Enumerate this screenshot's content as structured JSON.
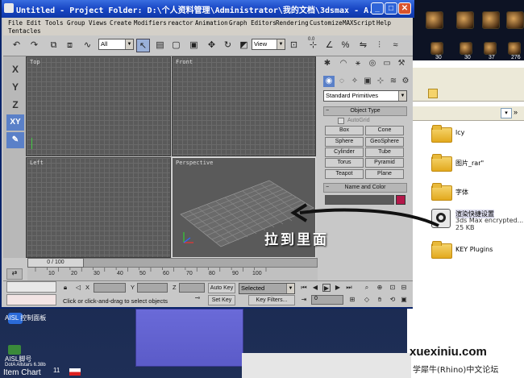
{
  "max": {
    "title": "Untitled   - Project Folder: D:\\个人资料管理\\Administrator\\我的文档\\3dsmax   - A...",
    "menus": [
      "File",
      "Edit",
      "Tools",
      "Group",
      "Views",
      "Create",
      "Modifiers",
      "reactor",
      "Animation",
      "Graph Editors",
      "Rendering",
      "Customize",
      "MAXScript",
      "Help",
      "Tentacles"
    ],
    "toolbar": {
      "selection_filter": "All",
      "ref_coord": "View",
      "spinner_value": "0.0"
    },
    "axis_buttons": [
      "X",
      "Y",
      "Z",
      "XY"
    ],
    "viewports": {
      "top": "Top",
      "front": "Front",
      "left": "Left",
      "perspective": "Perspective"
    },
    "command_panel": {
      "category": "Standard Primitives",
      "object_type_title": "Object Type",
      "autogrid": "AutoGrid",
      "primitives": [
        "Box",
        "Cone",
        "Sphere",
        "GeoSphere",
        "Cylinder",
        "Tube",
        "Torus",
        "Pyramid",
        "Teapot",
        "Plane"
      ],
      "name_color_title": "Name and Color"
    },
    "time_slider": "0 / 100",
    "ruler_ticks": [
      "10",
      "20",
      "30",
      "40",
      "50",
      "60",
      "70",
      "80",
      "90",
      "100"
    ],
    "status": {
      "x_label": "X",
      "y_label": "Y",
      "z_label": "Z",
      "prompt": "Click or click-and-drag to select objects",
      "auto_key": "Auto Key",
      "selected": "Selected",
      "set_key": "Set Key",
      "key_filters": "Key Filters...",
      "frame": "0"
    },
    "colors": {
      "title_bar": "#1846c4",
      "swatch": "#b4184a"
    }
  },
  "explorer": {
    "items": [
      {
        "name": "lcy",
        "type": "folder"
      },
      {
        "name": "图片_rar\"",
        "type": "folder"
      },
      {
        "name": "字体",
        "type": "folder"
      },
      {
        "name": "渲染快捷设置",
        "type": "file",
        "desc": "3ds Max encrypted...",
        "size": "25 KB"
      },
      {
        "name": "KEY Plugins",
        "type": "folder"
      }
    ],
    "toolbar_label": "»"
  },
  "game_counts": [
    "30",
    "30",
    "37",
    "276"
  ],
  "desktop": {
    "aisl_label": "AISL 控制面板",
    "aisl2": "AISL脚号",
    "dota": "DotA Allstars 6.38b",
    "item_chart": "Item Chart",
    "num11": "11"
  },
  "annotation": "拉到里面",
  "watermark": {
    "site": "xuexiniu.com",
    "forum": "学犀牛(Rhino)中文论坛"
  }
}
